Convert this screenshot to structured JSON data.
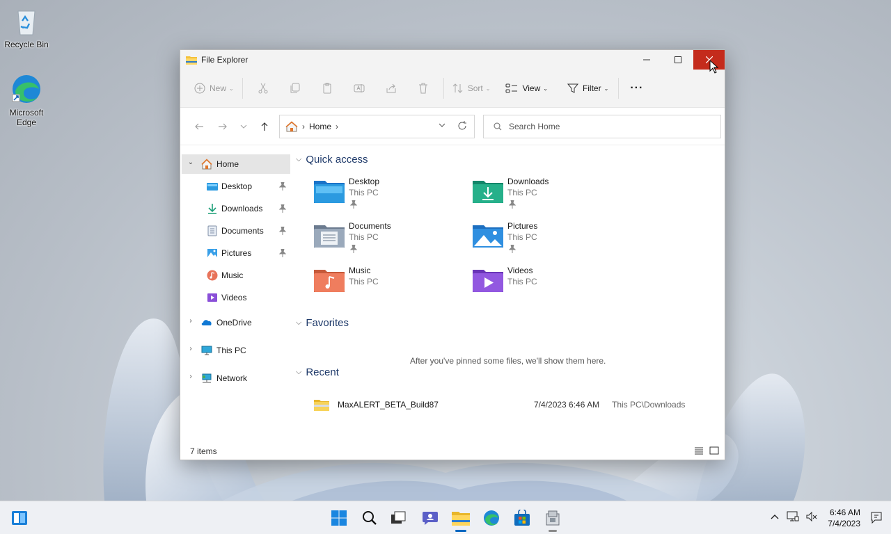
{
  "desktop": {
    "icons": [
      {
        "label": "Recycle Bin",
        "icon": "recycle-bin-icon"
      },
      {
        "label_line1": "Microsoft",
        "label_line2": "Edge",
        "icon": "edge-icon"
      }
    ]
  },
  "window": {
    "title": "File Explorer",
    "controls": {
      "minimize": "minimize-icon",
      "maximize": "maximize-icon",
      "close": "close-icon",
      "close_hover_color": "#c42b1c"
    }
  },
  "toolbar": {
    "new_label": "New",
    "sort_label": "Sort",
    "view_label": "View",
    "filter_label": "Filter",
    "more_label": "···"
  },
  "address": {
    "crumb": "Home",
    "search_placeholder": "Search Home"
  },
  "sidebar": {
    "home": "Home",
    "pinned": [
      {
        "label": "Desktop",
        "icon": "desktop-folder-icon",
        "pinned": true
      },
      {
        "label": "Downloads",
        "icon": "download-icon",
        "pinned": true
      },
      {
        "label": "Documents",
        "icon": "documents-icon",
        "pinned": true
      },
      {
        "label": "Pictures",
        "icon": "pictures-icon",
        "pinned": true
      },
      {
        "label": "Music",
        "icon": "music-icon",
        "pinned": false
      },
      {
        "label": "Videos",
        "icon": "videos-icon",
        "pinned": false
      }
    ],
    "onedrive": "OneDrive",
    "thispc": "This PC",
    "network": "Network"
  },
  "content": {
    "quick_access_title": "Quick access",
    "quick_access": [
      {
        "name": "Desktop",
        "location": "This PC",
        "pinned": true
      },
      {
        "name": "Downloads",
        "location": "This PC",
        "pinned": true
      },
      {
        "name": "Documents",
        "location": "This PC",
        "pinned": true
      },
      {
        "name": "Pictures",
        "location": "This PC",
        "pinned": true
      },
      {
        "name": "Music",
        "location": "This PC",
        "pinned": false
      },
      {
        "name": "Videos",
        "location": "This PC",
        "pinned": false
      }
    ],
    "favorites_title": "Favorites",
    "favorites_empty": "After you've pinned some files, we'll show them here.",
    "recent_title": "Recent",
    "recent": [
      {
        "name": "MaxALERT_BETA_Build87",
        "date": "7/4/2023 6:46 AM",
        "location": "This PC\\Downloads"
      }
    ]
  },
  "status": {
    "items": "7 items"
  },
  "taskbar": {
    "time": "6:46 AM",
    "date": "7/4/2023",
    "accent": "#0067c0"
  }
}
